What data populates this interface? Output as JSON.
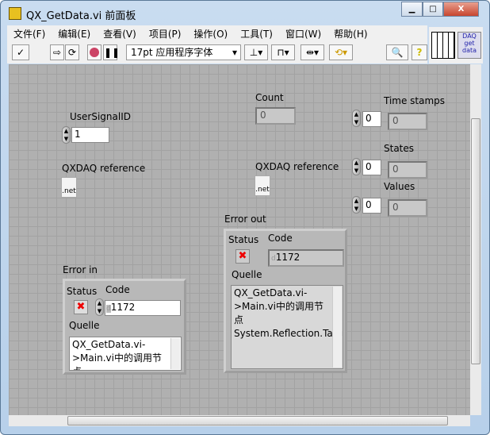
{
  "window": {
    "title": "QX_GetData.vi 前面板",
    "min": "▁",
    "max": "□",
    "close": "X"
  },
  "menu": [
    "文件(F)",
    "编辑(E)",
    "查看(V)",
    "项目(P)",
    "操作(O)",
    "工具(T)",
    "窗口(W)",
    "帮助(H)"
  ],
  "toolbar": {
    "run": "✓",
    "run_cont": "⇨",
    "font": "17pt 应用程序字体",
    "dropdown": "▾"
  },
  "daq_icon": "DAQ get data",
  "controls": {
    "user_signal_label": "UserSignalID",
    "user_signal_value": "1",
    "qxdaq_ref_in": "QXDAQ reference",
    "net_label": ".net",
    "count_label": "Count",
    "count_value": "0",
    "qxdaq_ref_out": "QXDAQ reference",
    "time_stamps": {
      "label": "Time stamps",
      "index": "0",
      "value": "0"
    },
    "states": {
      "label": "States",
      "index": "0",
      "value": "0"
    },
    "values": {
      "label": "Values",
      "index": "0",
      "value": "0"
    }
  },
  "error_in": {
    "label": "Error in",
    "status_label": "Status",
    "status": "✖",
    "code_label": "Code",
    "code": "1172",
    "radix": "d",
    "source_label": "Quelle",
    "source": "QX_GetData.vi->Main.vi中的调用节点"
  },
  "error_out": {
    "label": "Error out",
    "status_label": "Status",
    "status": "✖",
    "code_label": "Code",
    "code": "1172",
    "radix": "d",
    "source_label": "Quelle",
    "source": "QX_GetData.vi->Main.vi中的调用节点\nSystem.Reflection.TargetInvocationException:"
  }
}
